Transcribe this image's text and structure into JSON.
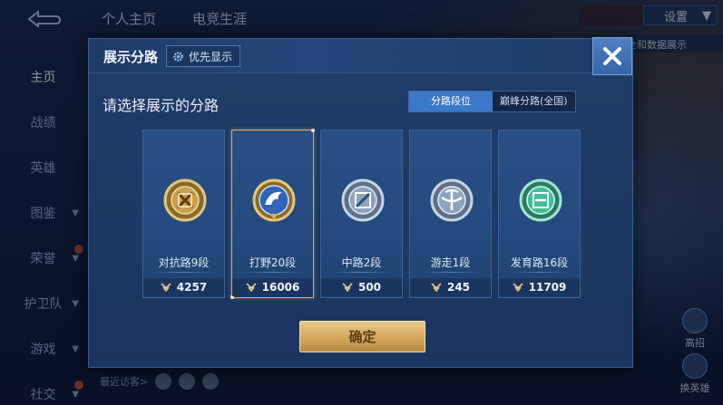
{
  "top_nav": {
    "back_icon": "back-arrow-icon",
    "tabs": [
      "个人主页",
      "电竞生涯"
    ],
    "settings_label": "设置",
    "right_note": "全和数据展示"
  },
  "left_nav": {
    "items": [
      {
        "label": "主页",
        "active": true,
        "has_chevron": false,
        "badge": false
      },
      {
        "label": "战绩",
        "active": false,
        "has_chevron": false,
        "badge": false
      },
      {
        "label": "英雄",
        "active": false,
        "has_chevron": false,
        "badge": false
      },
      {
        "label": "图鉴",
        "active": false,
        "has_chevron": true,
        "badge": false
      },
      {
        "label": "荣誉",
        "active": false,
        "has_chevron": true,
        "badge": true
      },
      {
        "label": "护卫队",
        "active": false,
        "has_chevron": true,
        "badge": false
      },
      {
        "label": "游戏",
        "active": false,
        "has_chevron": true,
        "badge": false
      },
      {
        "label": "社交",
        "active": false,
        "has_chevron": true,
        "badge": true
      }
    ]
  },
  "bottom_bar": {
    "visitor_label": "最近访客>"
  },
  "side_buttons": [
    {
      "label": "高招"
    },
    {
      "label": "换英雄"
    }
  ],
  "modal": {
    "title": "展示分路",
    "priority_label": "优先显示",
    "subtitle": "请选择展示的分路",
    "segment": {
      "options": [
        "分路段位",
        "巅峰分路(全国)"
      ],
      "selected_index": 0
    },
    "cards": [
      {
        "lane": "对抗路9段",
        "score": "4257",
        "emblem": "clash-lane-emblem-icon",
        "selected": false
      },
      {
        "lane": "打野20段",
        "score": "16006",
        "emblem": "jungle-emblem-icon",
        "selected": true
      },
      {
        "lane": "中路2段",
        "score": "500",
        "emblem": "mid-lane-emblem-icon",
        "selected": false
      },
      {
        "lane": "游走1段",
        "score": "245",
        "emblem": "roam-emblem-icon",
        "selected": false
      },
      {
        "lane": "发育路16段",
        "score": "11709",
        "emblem": "farm-lane-emblem-icon",
        "selected": false
      }
    ],
    "confirm_label": "确定",
    "colors": {
      "accent_gold": "#d3a65c",
      "selected_border": "#e0a96a",
      "segment_active": "#3a78c9"
    }
  }
}
